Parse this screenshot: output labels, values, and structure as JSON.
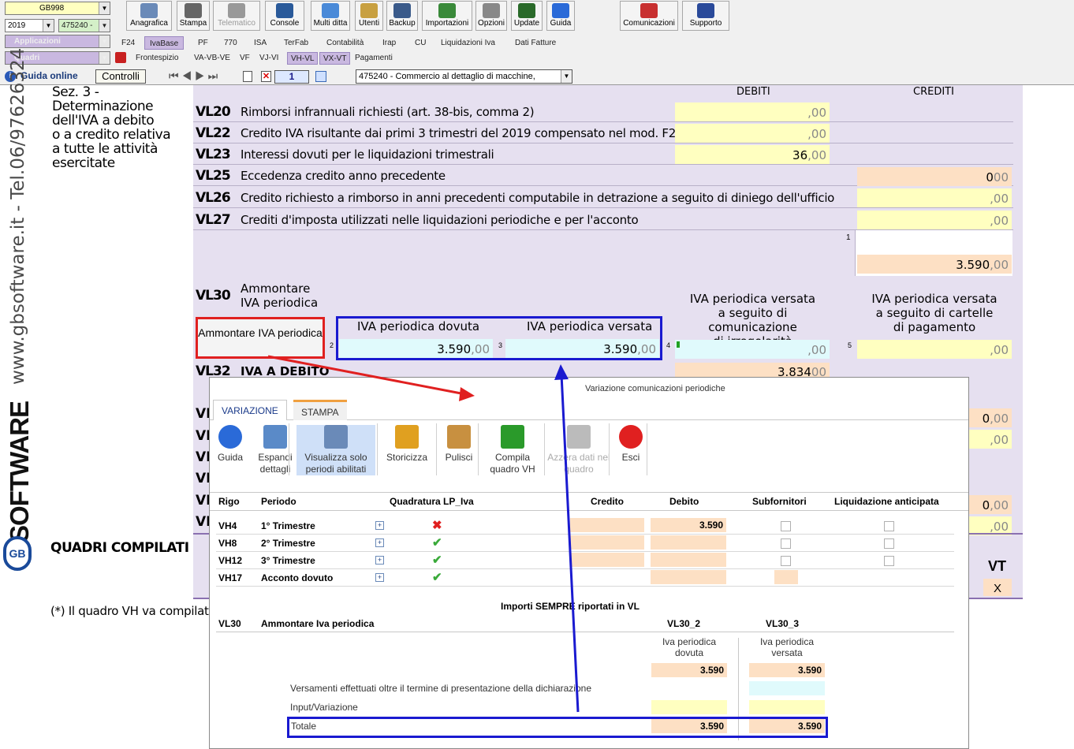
{
  "toolbar": {
    "combo_code": "GB998",
    "combo_year": "2019",
    "combo_id": "475240 -",
    "applicazioni": "Applicazioni",
    "quadri": "Quadri",
    "buttons": [
      "Anagrafica",
      "Stampa",
      "Telematico",
      "Console",
      "Multi ditta",
      "Utenti",
      "Backup",
      "Importazioni",
      "Opzioni",
      "Update",
      "Guida",
      "Comunicazioni",
      "Supporto"
    ],
    "tabs": [
      "F24",
      "IvaBase",
      "PF",
      "770",
      "ISA",
      "TerFab",
      "Contabilità",
      "Irap",
      "CU",
      "Liquidazioni Iva",
      "Dati Fatture"
    ],
    "subtabs": [
      "Frontespizio",
      "VA-VB-VE",
      "VF",
      "VJ-VI",
      "VH-VL",
      "VX-VT",
      "Pagamenti"
    ],
    "guida_online": "Guida online",
    "controlli": "Controlli",
    "page_num": "1",
    "company": "475240 - Commercio al dettaglio di macchine,"
  },
  "side": {
    "vertical_text": "www.gbsoftware.it - Tel.06/97626324",
    "brand": "SOFTWARE",
    "brand_gb": "GB"
  },
  "form": {
    "section": [
      "Sez. 3 -",
      "Determinazione",
      "dell'IVA a debito",
      "o a credito relativa",
      "a tutte le attività",
      "esercitate"
    ],
    "debiti": "DEBITI",
    "crediti": "CREDITI",
    "rows": [
      {
        "code": "VL20",
        "desc": "Rimborsi infrannuali richiesti (art. 38-bis, comma 2)"
      },
      {
        "code": "VL22",
        "desc": "Credito IVA risultante dai primi 3 trimestri del 2019 compensato nel mod. F24"
      },
      {
        "code": "VL23",
        "desc": "Interessi dovuti per le liquidazioni trimestrali"
      },
      {
        "code": "VL25",
        "desc": "Eccedenza credito anno precedente"
      },
      {
        "code": "VL26",
        "desc": "Credito richiesto a rimborso in anni precedenti computabile in detrazione a seguito di diniego dell'ufficio"
      },
      {
        "code": "VL27",
        "desc": "Crediti d'imposta utilizzati nelle liquidazioni periodiche e per l'acconto"
      }
    ],
    "vl23_value": "36",
    "vl25_value": "0",
    "total_value": "3.590",
    "dec": ",00",
    "dec_plain": "00",
    "marker1": "1",
    "vl30_code": "VL30",
    "vl30_desc": [
      "Ammontare",
      "IVA periodica"
    ],
    "ammontare_box": "Ammontare IVA periodica",
    "iva_dovuta": "IVA periodica dovuta",
    "iva_versata": "IVA periodica versata",
    "iva_irregolarita": [
      "IVA periodica versata",
      "a seguito di comunicazione",
      "di irregolarità"
    ],
    "iva_cartelle": [
      "IVA periodica versata",
      "a seguito di cartelle",
      "di pagamento"
    ],
    "dovuta_value": "3.590",
    "versata_value": "3.590",
    "num2": "2",
    "num3": "3",
    "num4": "4",
    "num5": "5",
    "vl32_code": "VL32",
    "vl32_desc": "IVA A DEBITO",
    "vl32_value": "3.834",
    "vl_partial": "VL",
    "right_zero": "0",
    "quadri_compilati": "QUADRI COMPILATI",
    "vt": "VT",
    "vt_x": "X",
    "footnote": "(*) Il quadro VH va compilato s"
  },
  "dialog": {
    "title": "Variazione comunicazioni periodiche",
    "tabs": [
      "VARIAZIONE",
      "STAMPA"
    ],
    "ribbon": [
      {
        "label": "Guida",
        "icon": "help-icon"
      },
      {
        "label": "Espandi dettagli",
        "icon": "expand-icon"
      },
      {
        "label": "Visualizza solo periodi abilitati",
        "icon": "filter-icon"
      },
      {
        "label": "Storicizza",
        "icon": "lock-icon"
      },
      {
        "label": "Pulisci",
        "icon": "broom-icon"
      },
      {
        "label": "Compila quadro VH",
        "icon": "arrow-icon"
      },
      {
        "label": "Azzera dati nel quadro",
        "icon": "clear-icon"
      },
      {
        "label": "Esci",
        "icon": "exit-icon"
      }
    ],
    "headers": [
      "Rigo",
      "Periodo",
      "Quadratura LP_Iva",
      "Credito",
      "Debito",
      "Subfornitori",
      "Liquidazione anticipata"
    ],
    "rows": [
      {
        "rigo": "VH4",
        "periodo": "1° Trimestre",
        "status": "error",
        "debito": "3.590"
      },
      {
        "rigo": "VH8",
        "periodo": "2° Trimestre",
        "status": "ok",
        "debito": ""
      },
      {
        "rigo": "VH12",
        "periodo": "3° Trimestre",
        "status": "ok",
        "debito": ""
      },
      {
        "rigo": "VH17",
        "periodo": "Acconto dovuto",
        "status": "ok",
        "debito": ""
      }
    ],
    "importi_title": "Importi SEMPRE riportati in VL",
    "vl30": "VL30",
    "vl30_desc": "Ammontare Iva periodica",
    "col_vl30_2": "VL30_2",
    "col_vl30_3": "VL30_3",
    "col_dovuta": "Iva periodica dovuta",
    "col_versata": "Iva periodica versata",
    "dovuta_value": "3.590",
    "versata_value": "3.590",
    "versamenti_label": "Versamenti effettuati oltre il termine di presentazione della dichiarazione",
    "input_label": "Input/Variazione",
    "totale_label": "Totale",
    "totale_dovuta": "3.590",
    "totale_versata": "3.590"
  },
  "colors": {
    "accent_red": "#e02020",
    "accent_blue": "#1a1ad0",
    "lilac": "#e6e0f0",
    "peach": "#fde0c4",
    "yellow": "#ffffc0"
  }
}
